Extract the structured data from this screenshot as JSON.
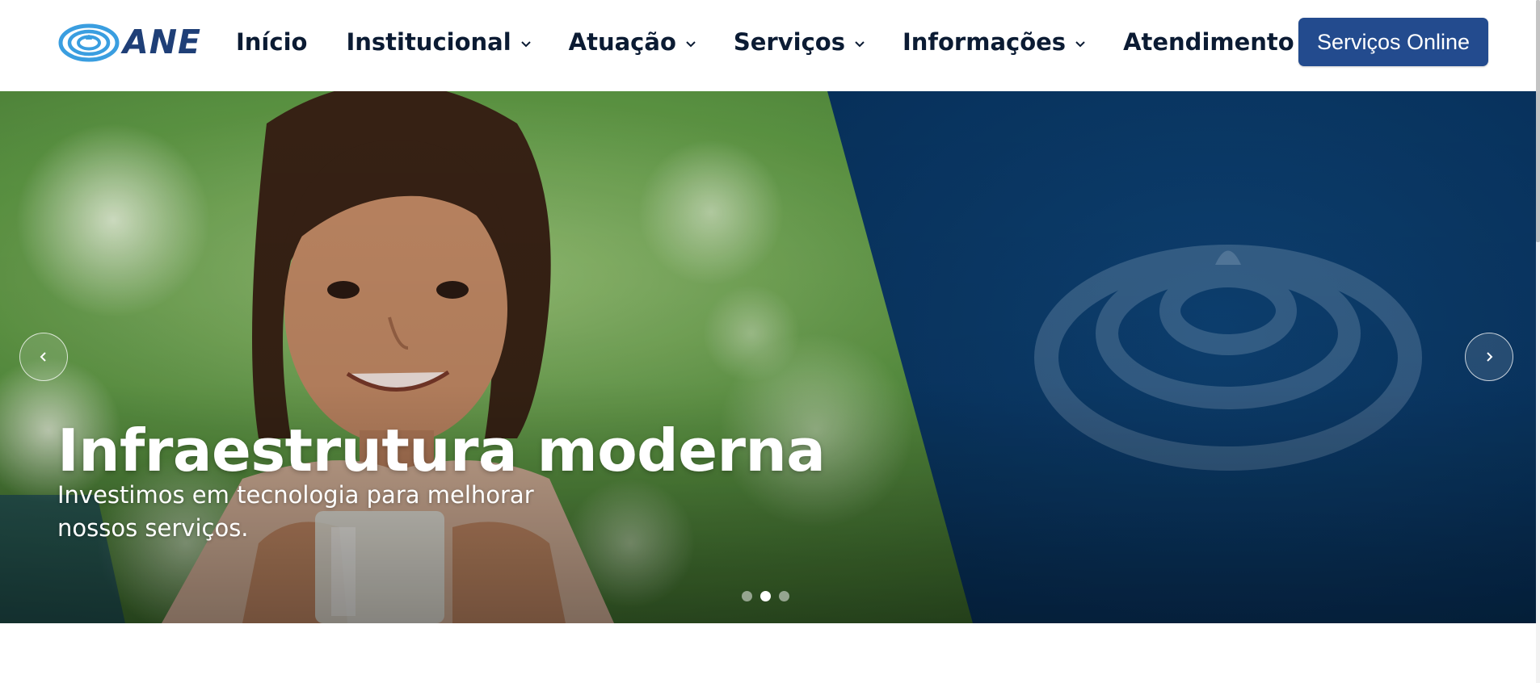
{
  "brand": {
    "logo_text": "ANE",
    "logo_color": "#1f3f77",
    "logo_accent": "#3a9ee0"
  },
  "nav": {
    "items": [
      {
        "label": "Início",
        "has_dropdown": false
      },
      {
        "label": "Institucional",
        "has_dropdown": true
      },
      {
        "label": "Atuação",
        "has_dropdown": true
      },
      {
        "label": "Serviços",
        "has_dropdown": true
      },
      {
        "label": "Informações",
        "has_dropdown": true
      },
      {
        "label": "Atendimento",
        "has_dropdown": true
      }
    ],
    "cta_label": "Serviços Online",
    "cta_color": "#234b8e"
  },
  "hero": {
    "title": "Infraestrutura moderna",
    "subtitle": "Investimos em tecnologia para melhorar nossos serviços.",
    "prev_icon": "chevron-left-icon",
    "next_icon": "chevron-right-icon",
    "slides_count": 3,
    "active_slide": 2,
    "panel_color": "#0a3663"
  }
}
